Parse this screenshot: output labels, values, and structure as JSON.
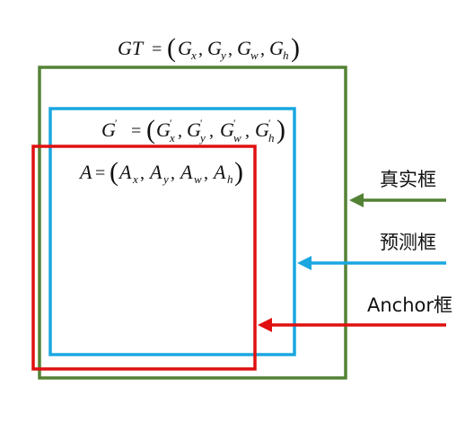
{
  "colors": {
    "ground_truth": "#548235",
    "prediction": "#1aa7e0",
    "anchor": "#e01010",
    "text": "#111111"
  },
  "formulas": {
    "gt": {
      "lhs": "GT",
      "terms": [
        {
          "base": "G",
          "sub": "x"
        },
        {
          "base": "G",
          "sub": "y"
        },
        {
          "base": "G",
          "sub": "w"
        },
        {
          "base": "G",
          "sub": "h"
        }
      ]
    },
    "pred": {
      "lhs": "G",
      "terms": [
        {
          "base": "G",
          "sub": "x"
        },
        {
          "base": "G",
          "sub": "y"
        },
        {
          "base": "G",
          "sub": "w"
        },
        {
          "base": "G",
          "sub": "h"
        }
      ]
    },
    "anchor": {
      "lhs": "A",
      "terms": [
        {
          "base": "A",
          "sub": "x"
        },
        {
          "base": "A",
          "sub": "y"
        },
        {
          "base": "A",
          "sub": "w"
        },
        {
          "base": "A",
          "sub": "h"
        }
      ]
    }
  },
  "labels": {
    "ground_truth": "真实框",
    "prediction": "预测框",
    "anchor": "Anchor框"
  }
}
